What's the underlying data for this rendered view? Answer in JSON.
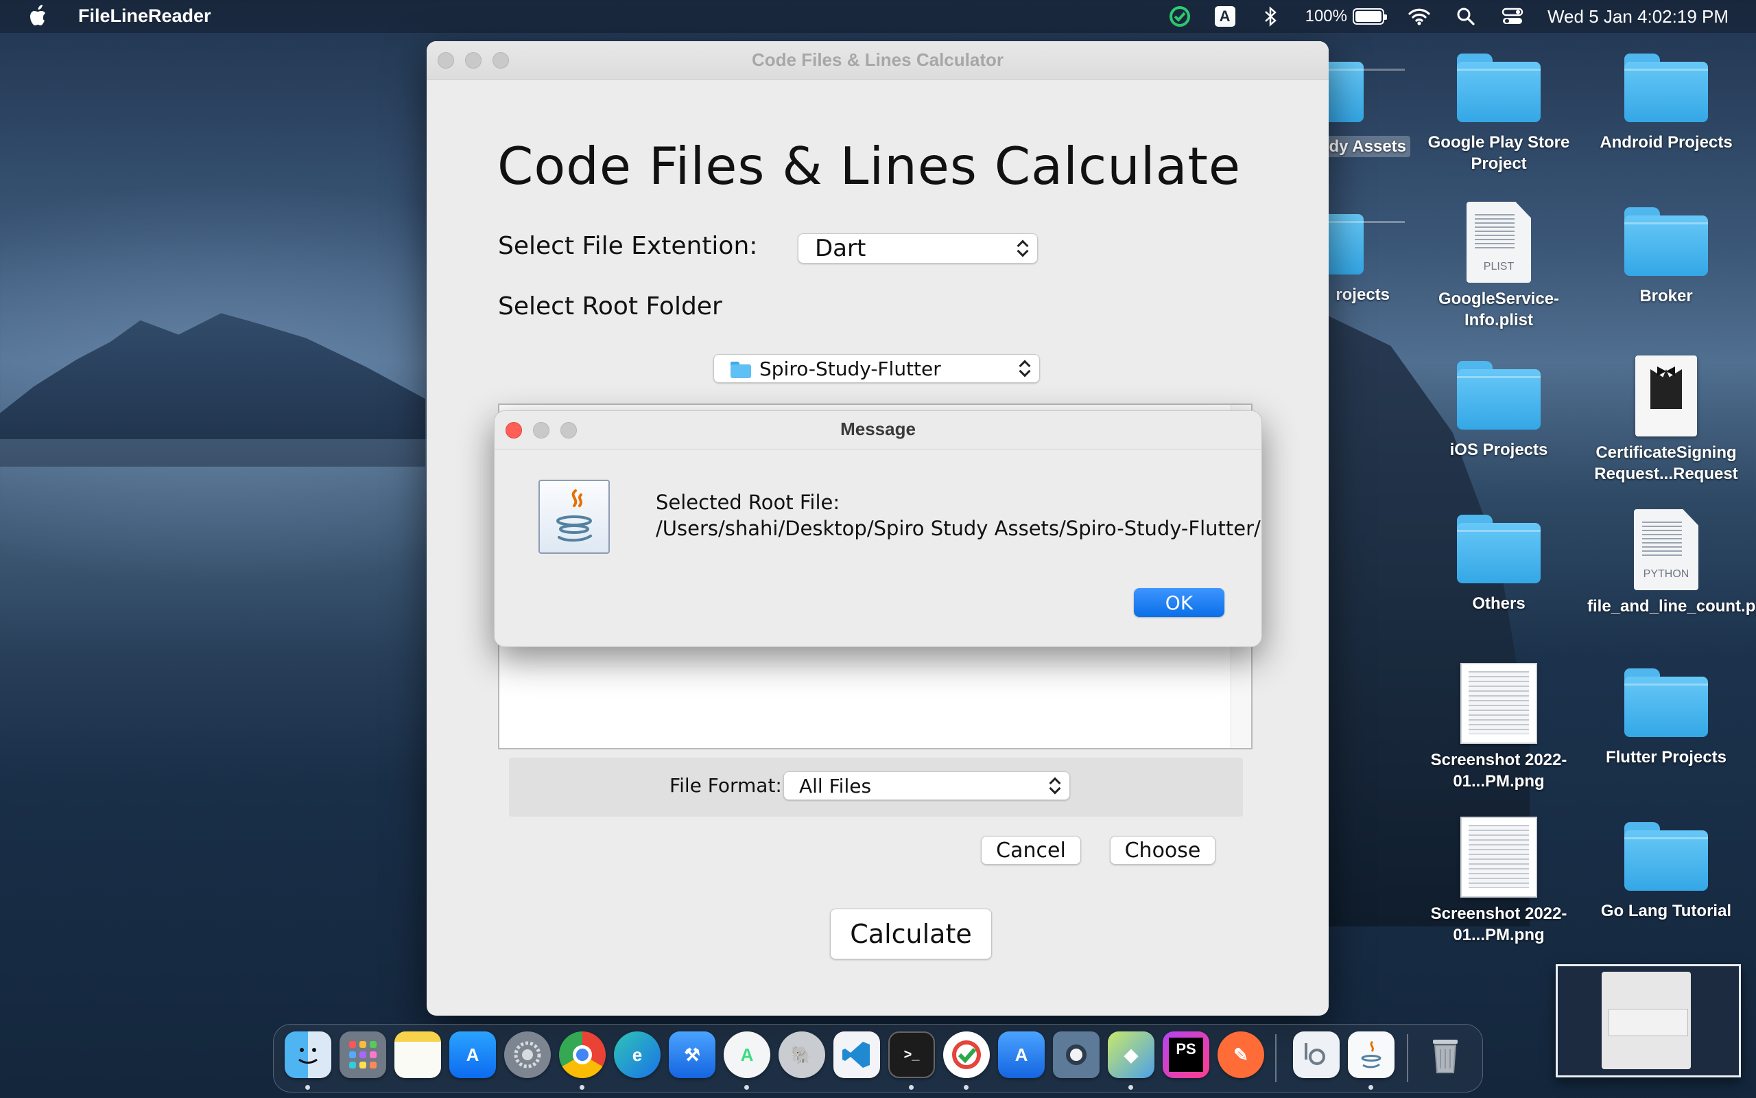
{
  "menubar": {
    "app_name": "FileLineReader",
    "input_letter": "A",
    "battery": "100%",
    "datetime": "Wed 5 Jan  4:02:19 PM"
  },
  "desktop": {
    "icons": [
      {
        "label": "dy Assets",
        "type": "folder"
      },
      {
        "label": "Google Play Store Project",
        "type": "folder"
      },
      {
        "label": "Android Projects",
        "type": "folder"
      },
      {
        "label": "rojects",
        "type": "folder"
      },
      {
        "label": "GoogleService-Info.plist",
        "type": "document",
        "tag": "PLIST"
      },
      {
        "label": "Broker",
        "type": "folder"
      },
      {
        "label": "iOS Projects",
        "type": "folder"
      },
      {
        "label": "CertificateSigning Request...Request",
        "type": "certificate"
      },
      {
        "label": "Others",
        "type": "folder"
      },
      {
        "label": "file_and_line_count.py",
        "type": "document",
        "tag": "PYTHON"
      },
      {
        "label": "Screenshot 2022-01...PM.png",
        "type": "image"
      },
      {
        "label": "Flutter Projects",
        "type": "folder"
      },
      {
        "label": "Screenshot 2022-01...PM.png",
        "type": "image"
      },
      {
        "label": "Go Lang Tutorial",
        "type": "folder"
      }
    ]
  },
  "main_window": {
    "title": "Code Files & Lines Calculator",
    "heading": "Code Files & Lines Calculate",
    "extension_label": "Select File Extention:",
    "extension_value": "Dart",
    "root_label": "Select Root Folder",
    "folder_value": "Spiro-Study-Flutter",
    "file_format_label": "File Format:",
    "file_format_value": "All Files",
    "cancel_label": "Cancel",
    "choose_label": "Choose",
    "calculate_label": "Calculate"
  },
  "dialog": {
    "title": "Message",
    "line1": "Selected Root File:",
    "line2": "/Users/shahi/Desktop/Spiro Study Assets/Spiro-Study-Flutter/lib",
    "ok_label": "OK"
  },
  "dock": {
    "apps": [
      "Finder",
      "Launchpad",
      "Notes",
      "App Store",
      "System Preferences",
      "Chrome",
      "Edge",
      "Xcode",
      "Android Studio",
      "TablePlus",
      "VS Code",
      "Terminal",
      "TickTick",
      "Simulator",
      "Sequel",
      "Cubes",
      "PhpStorm",
      "Postman",
      "Preview",
      "Java",
      "Trash"
    ]
  },
  "colors": {
    "accent_blue": "#0a6fe8",
    "close_red": "#ff5f57",
    "folder_blue": "#4fb7ee"
  }
}
